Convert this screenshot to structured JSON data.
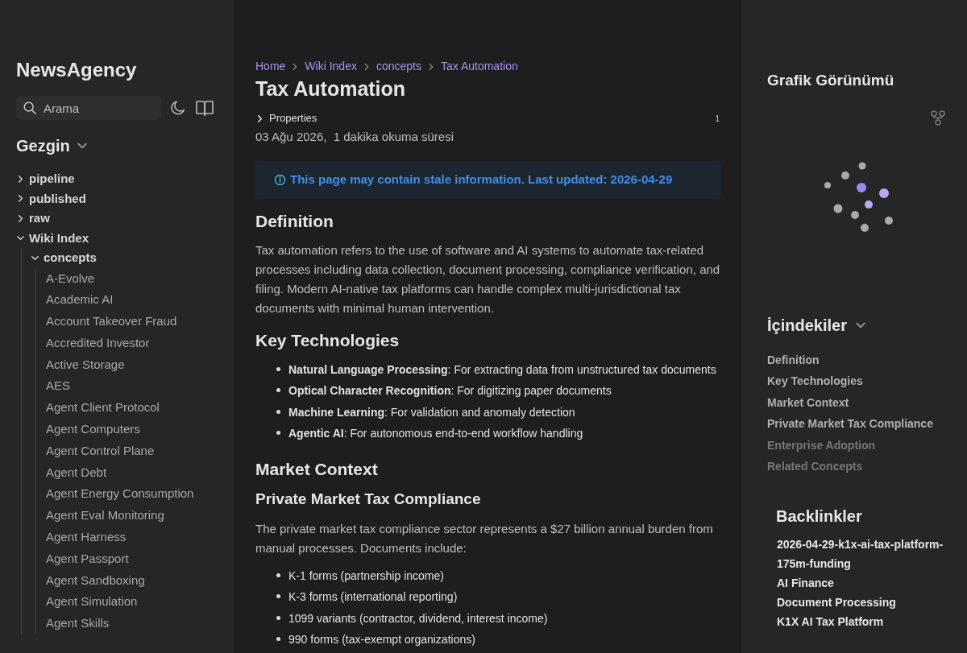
{
  "sidebar": {
    "site_title": "NewsAgency",
    "search": {
      "placeholder": "Arama"
    },
    "explorer": {
      "title": "Gezgin",
      "expanded": true
    },
    "tree": [
      {
        "label": "pipeline",
        "expanded": false
      },
      {
        "label": "published",
        "expanded": false
      },
      {
        "label": "raw",
        "expanded": false
      },
      {
        "label": "Wiki Index",
        "expanded": true,
        "children": [
          {
            "label": "concepts",
            "expanded": true,
            "children": [
              {
                "label": "A-Evolve"
              },
              {
                "label": "Academic AI"
              },
              {
                "label": "Account Takeover Fraud"
              },
              {
                "label": "Accredited Investor"
              },
              {
                "label": "Active Storage"
              },
              {
                "label": "AES"
              },
              {
                "label": "Agent Client Protocol"
              },
              {
                "label": "Agent Computers"
              },
              {
                "label": "Agent Control Plane"
              },
              {
                "label": "Agent Debt"
              },
              {
                "label": "Agent Energy Consumption"
              },
              {
                "label": "Agent Eval Monitoring"
              },
              {
                "label": "Agent Harness"
              },
              {
                "label": "Agent Passport"
              },
              {
                "label": "Agent Sandboxing"
              },
              {
                "label": "Agent Simulation"
              },
              {
                "label": "Agent Skills"
              }
            ]
          }
        ]
      }
    ]
  },
  "main": {
    "breadcrumbs": [
      "Home",
      "Wiki Index",
      "concepts",
      "Tax Automation"
    ],
    "title": "Tax Automation",
    "properties": {
      "label": "Properties",
      "count": "1",
      "expanded": false
    },
    "meta": "03 Ağu 2026,  1 dakika okuma süresi",
    "banner": "This page may contain stale information. Last updated: 2026-04-29",
    "blocks": [
      {
        "kind": "h2",
        "text": "Definition"
      },
      {
        "kind": "p",
        "text": "Tax automation refers to the use of software and AI systems to automate tax-related processes including data collection, document processing, compliance verification, and filing. Modern AI-native tax platforms can handle complex multi-jurisdictional tax documents with minimal human intervention."
      },
      {
        "kind": "h2",
        "text": "Key Technologies"
      },
      {
        "kind": "ul",
        "items": [
          "**Natural Language Processing**: For extracting data from unstructured tax documents",
          "**Optical Character Recognition**: For digitizing paper documents",
          "**Machine Learning**: For validation and anomaly detection",
          "**Agentic AI**: For autonomous end-to-end workflow handling"
        ]
      },
      {
        "kind": "h2",
        "text": "Market Context"
      },
      {
        "kind": "h3",
        "text": "Private Market Tax Compliance"
      },
      {
        "kind": "p",
        "text": "The private market tax compliance sector represents a $27 billion annual burden from manual processes. Documents include:"
      },
      {
        "kind": "ul",
        "items": [
          "K-1 forms (partnership income)",
          "K-3 forms (international reporting)",
          "1099 variants (contractor, dividend, interest income)",
          "990 forms (tax-exempt organizations)"
        ]
      }
    ]
  },
  "right": {
    "graph_title": "Grafik Görünümü",
    "toc": {
      "title": "İçindekiler",
      "expanded": true,
      "items": [
        {
          "label": "Definition",
          "faded": false
        },
        {
          "label": "Key Technologies",
          "faded": false
        },
        {
          "label": "Market Context",
          "faded": false
        },
        {
          "label": "Private Market Tax Compliance",
          "faded": false
        },
        {
          "label": "Enterprise Adoption",
          "faded": true
        },
        {
          "label": "Related Concepts",
          "faded": true
        }
      ]
    },
    "backlinks": {
      "title": "Backlinkler",
      "items": [
        "2026-04-29-k1x-ai-tax-platform-175m-funding",
        "AI Finance",
        "Document Processing",
        "K1X AI Tax Platform"
      ]
    }
  }
}
